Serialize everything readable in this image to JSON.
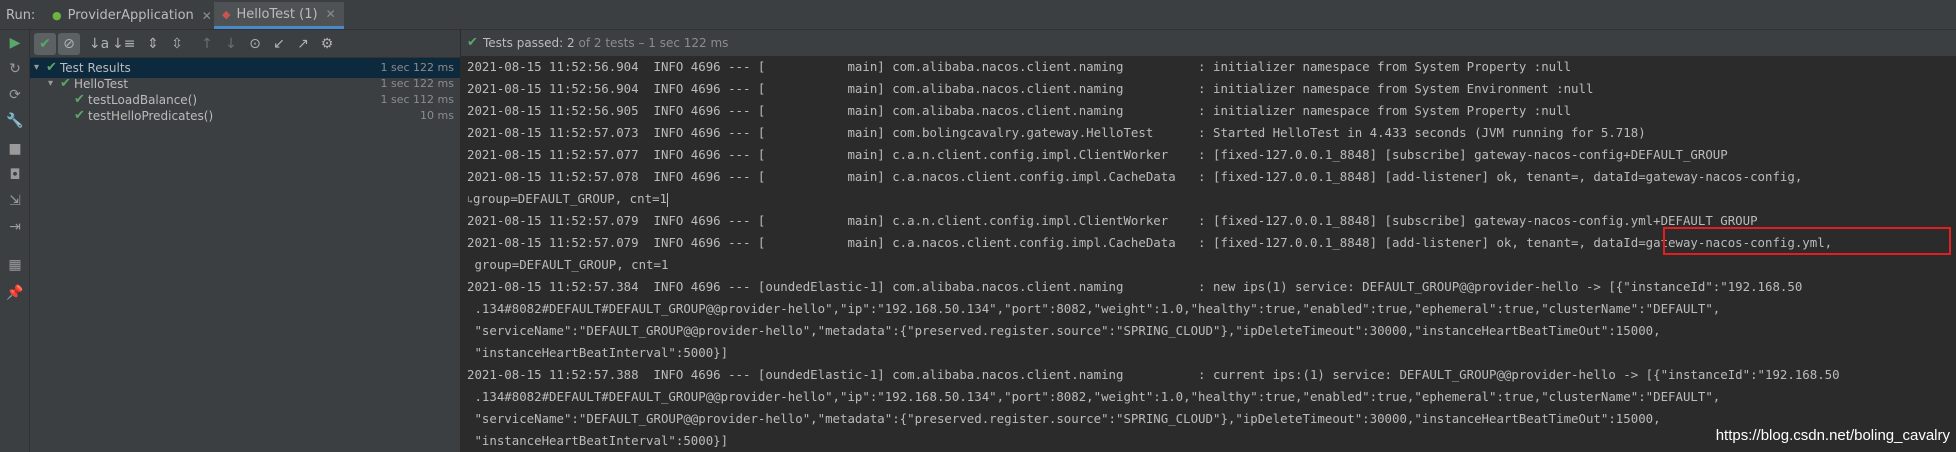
{
  "run_panel": {
    "label": "Run:",
    "tabs": [
      {
        "label": "ProviderApplication",
        "icon": "spring-boot-icon",
        "active": false
      },
      {
        "label": "HelloTest (1)",
        "icon": "test-config-icon",
        "active": true
      }
    ]
  },
  "status": {
    "prefix": "Tests passed:",
    "count": "2",
    "suffix": "of 2 tests – 1 sec 122 ms"
  },
  "tree": [
    {
      "label": "Test Results",
      "time": "1 sec 122 ms",
      "status": "passed"
    },
    {
      "label": "HelloTest",
      "time": "1 sec 122 ms",
      "status": "passed"
    },
    {
      "label": "testLoadBalance()",
      "time": "1 sec 112 ms",
      "status": "passed"
    },
    {
      "label": "testHelloPredicates()",
      "time": "10 ms",
      "status": "passed"
    }
  ],
  "console_lines": [
    "2021-08-15 11:52:56.904  INFO 4696 --- [           main] com.alibaba.nacos.client.naming          : initializer namespace from System Property :null",
    "2021-08-15 11:52:56.904  INFO 4696 --- [           main] com.alibaba.nacos.client.naming          : initializer namespace from System Environment :null",
    "2021-08-15 11:52:56.905  INFO 4696 --- [           main] com.alibaba.nacos.client.naming          : initializer namespace from System Property :null",
    "2021-08-15 11:52:57.073  INFO 4696 --- [           main] com.bolingcavalry.gateway.HelloTest      : Started HelloTest in 4.433 seconds (JVM running for 5.718)",
    "2021-08-15 11:52:57.077  INFO 4696 --- [           main] c.a.n.client.config.impl.ClientWorker    : [fixed-127.0.0.1_8848] [subscribe] gateway-nacos-config+DEFAULT_GROUP",
    "2021-08-15 11:52:57.078  INFO 4696 --- [           main] c.a.nacos.client.config.impl.CacheData   : [fixed-127.0.0.1_8848] [add-listener] ok, tenant=, dataId=gateway-nacos-config,",
    "group=DEFAULT_GROUP, cnt=1",
    "2021-08-15 11:52:57.079  INFO 4696 --- [           main] c.a.n.client.config.impl.ClientWorker    : [fixed-127.0.0.1_8848] [subscribe] gateway-nacos-config.yml+DEFAULT_GROUP",
    "2021-08-15 11:52:57.079  INFO 4696 --- [           main] c.a.nacos.client.config.impl.CacheData   : [fixed-127.0.0.1_8848] [add-listener] ok, tenant=, dataId=gateway-nacos-config.yml,",
    " group=DEFAULT_GROUP, cnt=1",
    "2021-08-15 11:52:57.384  INFO 4696 --- [oundedElastic-1] com.alibaba.nacos.client.naming          : new ips(1) service: DEFAULT_GROUP@@provider-hello -> [{\"instanceId\":\"192.168.50",
    " .134#8082#DEFAULT#DEFAULT_GROUP@@provider-hello\",\"ip\":\"192.168.50.134\",\"port\":8082,\"weight\":1.0,\"healthy\":true,\"enabled\":true,\"ephemeral\":true,\"clusterName\":\"DEFAULT\",",
    " \"serviceName\":\"DEFAULT_GROUP@@provider-hello\",\"metadata\":{\"preserved.register.source\":\"SPRING_CLOUD\"},\"ipDeleteTimeout\":30000,\"instanceHeartBeatTimeOut\":15000,",
    " \"instanceHeartBeatInterval\":5000}]",
    "2021-08-15 11:52:57.388  INFO 4696 --- [oundedElastic-1] com.alibaba.nacos.client.naming          : current ips:(1) service: DEFAULT_GROUP@@provider-hello -> [{\"instanceId\":\"192.168.50",
    " .134#8082#DEFAULT#DEFAULT_GROUP@@provider-hello\",\"ip\":\"192.168.50.134\",\"port\":8082,\"weight\":1.0,\"healthy\":true,\"enabled\":true,\"ephemeral\":true,\"clusterName\":\"DEFAULT\",",
    " \"serviceName\":\"DEFAULT_GROUP@@provider-hello\",\"metadata\":{\"preserved.register.source\":\"SPRING_CLOUD\"},\"ipDeleteTimeout\":30000,\"instanceHeartBeatTimeOut\":15000,",
    " \"instanceHeartBeatInterval\":5000}]"
  ],
  "watermark": "https://blog.csdn.net/boling_cavalry",
  "colors": {
    "pass_green": "#59a869",
    "highlight_red": "#e02020",
    "selection": "#0d293e",
    "tab_underline": "#4a88c7"
  }
}
